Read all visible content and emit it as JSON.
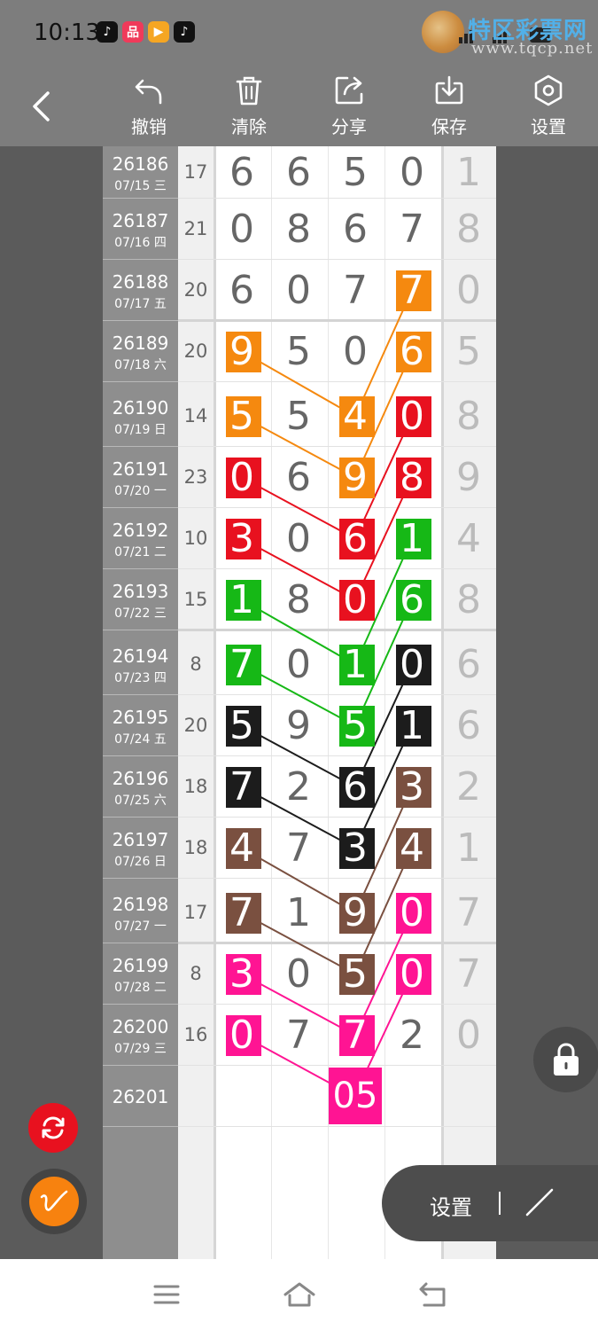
{
  "status_bar": {
    "time": "10:13",
    "app_icons": [
      "tiktok-icon",
      "app-icon-orange",
      "app-icon-video",
      "tiktok-icon"
    ],
    "watermark_text": "特区彩票网",
    "watermark_url": "www.tqcp.net"
  },
  "toolbar": {
    "back_icon": "chevron-left-icon",
    "items": [
      {
        "label": "撤销",
        "icon": "undo-icon"
      },
      {
        "label": "清除",
        "icon": "trash-icon"
      },
      {
        "label": "分享",
        "icon": "share-icon"
      },
      {
        "label": "保存",
        "icon": "download-icon"
      },
      {
        "label": "设置",
        "icon": "hexagon-gear-icon"
      }
    ]
  },
  "colors": {
    "orange": "#f5890f",
    "red": "#e8111f",
    "green": "#16b816",
    "black": "#1c1c1c",
    "brown": "#7a5040",
    "pink": "#ff1493"
  },
  "rows": [
    {
      "id": "26186",
      "date": "07/15 三",
      "sum": "17",
      "digits": [
        "6",
        "6",
        "5",
        "0",
        "1"
      ]
    },
    {
      "id": "26187",
      "date": "07/16 四",
      "sum": "21",
      "digits": [
        "0",
        "8",
        "6",
        "7",
        "8"
      ]
    },
    {
      "id": "26188",
      "date": "07/17 五",
      "sum": "20",
      "digits": [
        "6",
        "0",
        "7",
        "7",
        "0"
      ]
    },
    {
      "id": "26189",
      "date": "07/18 六",
      "sum": "20",
      "digits": [
        "9",
        "5",
        "0",
        "6",
        "5"
      ]
    },
    {
      "id": "26190",
      "date": "07/19 日",
      "sum": "14",
      "digits": [
        "5",
        "5",
        "4",
        "0",
        "8"
      ]
    },
    {
      "id": "26191",
      "date": "07/20 一",
      "sum": "23",
      "digits": [
        "0",
        "6",
        "9",
        "8",
        "9"
      ]
    },
    {
      "id": "26192",
      "date": "07/21 二",
      "sum": "10",
      "digits": [
        "3",
        "0",
        "6",
        "1",
        "4"
      ]
    },
    {
      "id": "26193",
      "date": "07/22 三",
      "sum": "15",
      "digits": [
        "1",
        "8",
        "0",
        "6",
        "8"
      ]
    },
    {
      "id": "26194",
      "date": "07/23 四",
      "sum": "8",
      "digits": [
        "7",
        "0",
        "1",
        "0",
        "6"
      ]
    },
    {
      "id": "26195",
      "date": "07/24 五",
      "sum": "20",
      "digits": [
        "5",
        "9",
        "5",
        "1",
        "6"
      ]
    },
    {
      "id": "26196",
      "date": "07/25 六",
      "sum": "18",
      "digits": [
        "7",
        "2",
        "6",
        "3",
        "2"
      ]
    },
    {
      "id": "26197",
      "date": "07/26 日",
      "sum": "18",
      "digits": [
        "4",
        "7",
        "3",
        "4",
        "1"
      ]
    },
    {
      "id": "26198",
      "date": "07/27 一",
      "sum": "17",
      "digits": [
        "7",
        "1",
        "9",
        "0",
        "7"
      ]
    },
    {
      "id": "26199",
      "date": "07/28 二",
      "sum": "8",
      "digits": [
        "3",
        "0",
        "5",
        "0",
        "7"
      ]
    },
    {
      "id": "26200",
      "date": "07/29 三",
      "sum": "16",
      "digits": [
        "0",
        "7",
        "7",
        "2",
        "0"
      ]
    },
    {
      "id": "26201",
      "date": "",
      "sum": "",
      "digits": [
        "",
        "",
        "",
        "",
        ""
      ]
    }
  ],
  "prediction": {
    "value": "05"
  },
  "highlights": [
    {
      "row": 2,
      "col": 3,
      "color": "orange"
    },
    {
      "row": 3,
      "col": 0,
      "color": "orange"
    },
    {
      "row": 3,
      "col": 3,
      "color": "orange"
    },
    {
      "row": 4,
      "col": 0,
      "color": "orange"
    },
    {
      "row": 4,
      "col": 2,
      "color": "orange"
    },
    {
      "row": 4,
      "col": 3,
      "color": "red"
    },
    {
      "row": 5,
      "col": 0,
      "color": "red"
    },
    {
      "row": 5,
      "col": 2,
      "color": "orange"
    },
    {
      "row": 5,
      "col": 3,
      "color": "red"
    },
    {
      "row": 6,
      "col": 0,
      "color": "red"
    },
    {
      "row": 6,
      "col": 2,
      "color": "red"
    },
    {
      "row": 6,
      "col": 3,
      "color": "green"
    },
    {
      "row": 7,
      "col": 0,
      "color": "green"
    },
    {
      "row": 7,
      "col": 2,
      "color": "red"
    },
    {
      "row": 7,
      "col": 3,
      "color": "green"
    },
    {
      "row": 8,
      "col": 0,
      "color": "green"
    },
    {
      "row": 8,
      "col": 2,
      "color": "green"
    },
    {
      "row": 8,
      "col": 3,
      "color": "black"
    },
    {
      "row": 9,
      "col": 0,
      "color": "black"
    },
    {
      "row": 9,
      "col": 2,
      "color": "green"
    },
    {
      "row": 9,
      "col": 3,
      "color": "black"
    },
    {
      "row": 10,
      "col": 0,
      "color": "black"
    },
    {
      "row": 10,
      "col": 2,
      "color": "black"
    },
    {
      "row": 10,
      "col": 3,
      "color": "brown"
    },
    {
      "row": 11,
      "col": 0,
      "color": "brown"
    },
    {
      "row": 11,
      "col": 2,
      "color": "black"
    },
    {
      "row": 11,
      "col": 3,
      "color": "brown"
    },
    {
      "row": 12,
      "col": 0,
      "color": "brown"
    },
    {
      "row": 12,
      "col": 2,
      "color": "brown"
    },
    {
      "row": 12,
      "col": 3,
      "color": "pink"
    },
    {
      "row": 13,
      "col": 0,
      "color": "pink"
    },
    {
      "row": 13,
      "col": 2,
      "color": "brown"
    },
    {
      "row": 13,
      "col": 3,
      "color": "pink"
    },
    {
      "row": 14,
      "col": 0,
      "color": "pink"
    },
    {
      "row": 14,
      "col": 2,
      "color": "pink"
    }
  ],
  "connections": [
    {
      "from": [
        2,
        3
      ],
      "to": [
        4,
        2
      ],
      "color": "orange"
    },
    {
      "from": [
        3,
        0
      ],
      "to": [
        4,
        2
      ],
      "color": "orange"
    },
    {
      "from": [
        3,
        3
      ],
      "to": [
        5,
        2
      ],
      "color": "orange"
    },
    {
      "from": [
        4,
        0
      ],
      "to": [
        5,
        2
      ],
      "color": "orange"
    },
    {
      "from": [
        4,
        3
      ],
      "to": [
        6,
        2
      ],
      "color": "red"
    },
    {
      "from": [
        5,
        0
      ],
      "to": [
        6,
        2
      ],
      "color": "red"
    },
    {
      "from": [
        5,
        3
      ],
      "to": [
        7,
        2
      ],
      "color": "red"
    },
    {
      "from": [
        6,
        0
      ],
      "to": [
        7,
        2
      ],
      "color": "red"
    },
    {
      "from": [
        6,
        3
      ],
      "to": [
        8,
        2
      ],
      "color": "green"
    },
    {
      "from": [
        7,
        0
      ],
      "to": [
        8,
        2
      ],
      "color": "green"
    },
    {
      "from": [
        7,
        3
      ],
      "to": [
        9,
        2
      ],
      "color": "green"
    },
    {
      "from": [
        8,
        0
      ],
      "to": [
        9,
        2
      ],
      "color": "green"
    },
    {
      "from": [
        8,
        3
      ],
      "to": [
        10,
        2
      ],
      "color": "black"
    },
    {
      "from": [
        9,
        0
      ],
      "to": [
        10,
        2
      ],
      "color": "black"
    },
    {
      "from": [
        9,
        3
      ],
      "to": [
        11,
        2
      ],
      "color": "black"
    },
    {
      "from": [
        10,
        0
      ],
      "to": [
        11,
        2
      ],
      "color": "black"
    },
    {
      "from": [
        10,
        3
      ],
      "to": [
        12,
        2
      ],
      "color": "brown"
    },
    {
      "from": [
        11,
        0
      ],
      "to": [
        12,
        2
      ],
      "color": "brown"
    },
    {
      "from": [
        11,
        3
      ],
      "to": [
        13,
        2
      ],
      "color": "brown"
    },
    {
      "from": [
        12,
        0
      ],
      "to": [
        13,
        2
      ],
      "color": "brown"
    },
    {
      "from": [
        12,
        3
      ],
      "to": [
        14,
        2
      ],
      "color": "pink"
    },
    {
      "from": [
        13,
        0
      ],
      "to": [
        14,
        2
      ],
      "color": "pink"
    },
    {
      "from": [
        13,
        3
      ],
      "to": [
        15,
        2
      ],
      "color": "pink"
    },
    {
      "from": [
        14,
        0
      ],
      "to": [
        15,
        2
      ],
      "color": "pink"
    }
  ],
  "floating": {
    "lock_icon": "lock-icon",
    "refresh_icon": "refresh-icon",
    "pen_icon": "pen-icon",
    "settings_label": "设置",
    "line_tool_icon": "line-tool-icon"
  },
  "nav_bar": {
    "items": [
      "menu-icon",
      "home-icon",
      "back-icon"
    ]
  }
}
